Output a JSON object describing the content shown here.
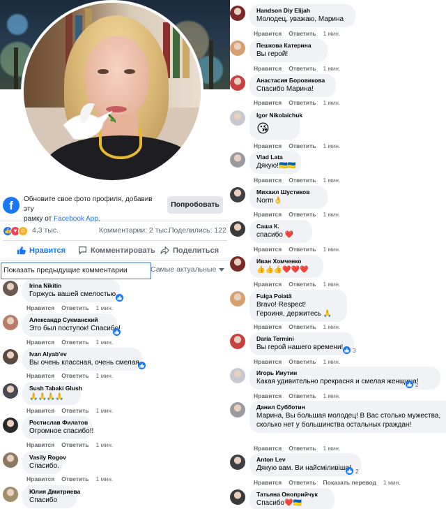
{
  "frame_prompt": {
    "text_line1": "Обновите свое фото профиля, добавив эту",
    "text_line2_prefix": "рамку от",
    "link": "Facebook App",
    "text_line2_suffix": ".",
    "button": "Попробовать"
  },
  "stats": {
    "reactions": "4,3 тыс.",
    "comments": "Комментарии: 2 тыс.",
    "shares": "Поделились: 122"
  },
  "actions": {
    "like": "Нравится",
    "comment": "Комментировать",
    "share": "Поделиться"
  },
  "comments_header": {
    "show_previous": "Показать предыдущие комментарии",
    "sort": "Самые актуальные"
  },
  "meta": {
    "like": "Нравится",
    "reply": "Ответить",
    "time": "1 мин.",
    "translate": "Показать перевод"
  },
  "left_comments": [
    {
      "name": "Irina Nikitin",
      "text": "Горжусь вашей смелостью.",
      "badge": ""
    },
    {
      "name": "Александр Сукманский",
      "text": "Это был поступок! Спасибо!",
      "badge": ""
    },
    {
      "name": "Ivan Alyab'ev",
      "text": "Вы очень классная, очень смелая",
      "badge": ""
    },
    {
      "name": "Sush Tabaki Glush",
      "text": "🙏🙏🙏🙏",
      "badge": ""
    },
    {
      "name": "Ростислав Филатов",
      "text": "Огромное спасибо!!",
      "badge": ""
    },
    {
      "name": "Vasily Rogov",
      "text": "Спасибо.",
      "badge": ""
    },
    {
      "name": "Юлия Дмитриева",
      "text": "Спасибо",
      "badge": ""
    }
  ],
  "right_comments": [
    {
      "name": "Handson Diy Elijah",
      "text": "Молодец, уважаю, Марина",
      "badge": ""
    },
    {
      "name": "Пешкова Катерина",
      "text": "Вы герой!",
      "badge": ""
    },
    {
      "name": "Анастасия Боровикова",
      "text": "Спасибо Марина!",
      "badge": ""
    },
    {
      "name": "Igor Nikolaichuk",
      "text": "😘",
      "badge": ""
    },
    {
      "name": "Vlad Lata",
      "text": "Дякую!🇺🇦🇺🇦",
      "badge": ""
    },
    {
      "name": "Михаил Шустиков",
      "text": "Norm👌",
      "badge": ""
    },
    {
      "name": "Саша К.",
      "text": "спасибо ❤️",
      "badge": ""
    },
    {
      "name": "Иван Хомченко",
      "text": "👍👍👍❤️❤️❤️",
      "badge": ""
    },
    {
      "name": "Fulga Poiată",
      "text": "Bravo! Respect!",
      "text2": "Героиня, держитесь 🙏",
      "badge": ""
    },
    {
      "name": "Daria Termini",
      "text": "Вы герой нашего времени!",
      "badge": "3"
    },
    {
      "name": "Игорь Ииутин",
      "text": "Какая удивительно прекрасня и смелая женщина!",
      "badge": "2"
    },
    {
      "name": "Данил Субботин",
      "text": "Марина, Вы большая молодец! В Вас столько мужества, сколько нет у большинства остальных граждан!",
      "badge": ""
    },
    {
      "name": "Anton Lev",
      "text": "Дякую вам. Ви найсміливіша!",
      "badge": "2"
    },
    {
      "name": "Татьяна Оноприйчук",
      "text": "Спасибо❤️🇺🇦",
      "badge": ""
    }
  ],
  "colors": {
    "brand": "#1877f2",
    "bubble": "#f0f2f5",
    "meta_text": "#65676b",
    "highlight_border": "#3b72b6"
  },
  "icons": [
    "facebook-logo-icon",
    "like-icon",
    "comment-icon",
    "share-icon",
    "chevron-down-icon",
    "like-reaction-icon",
    "love-reaction-icon",
    "care-reaction-icon"
  ]
}
